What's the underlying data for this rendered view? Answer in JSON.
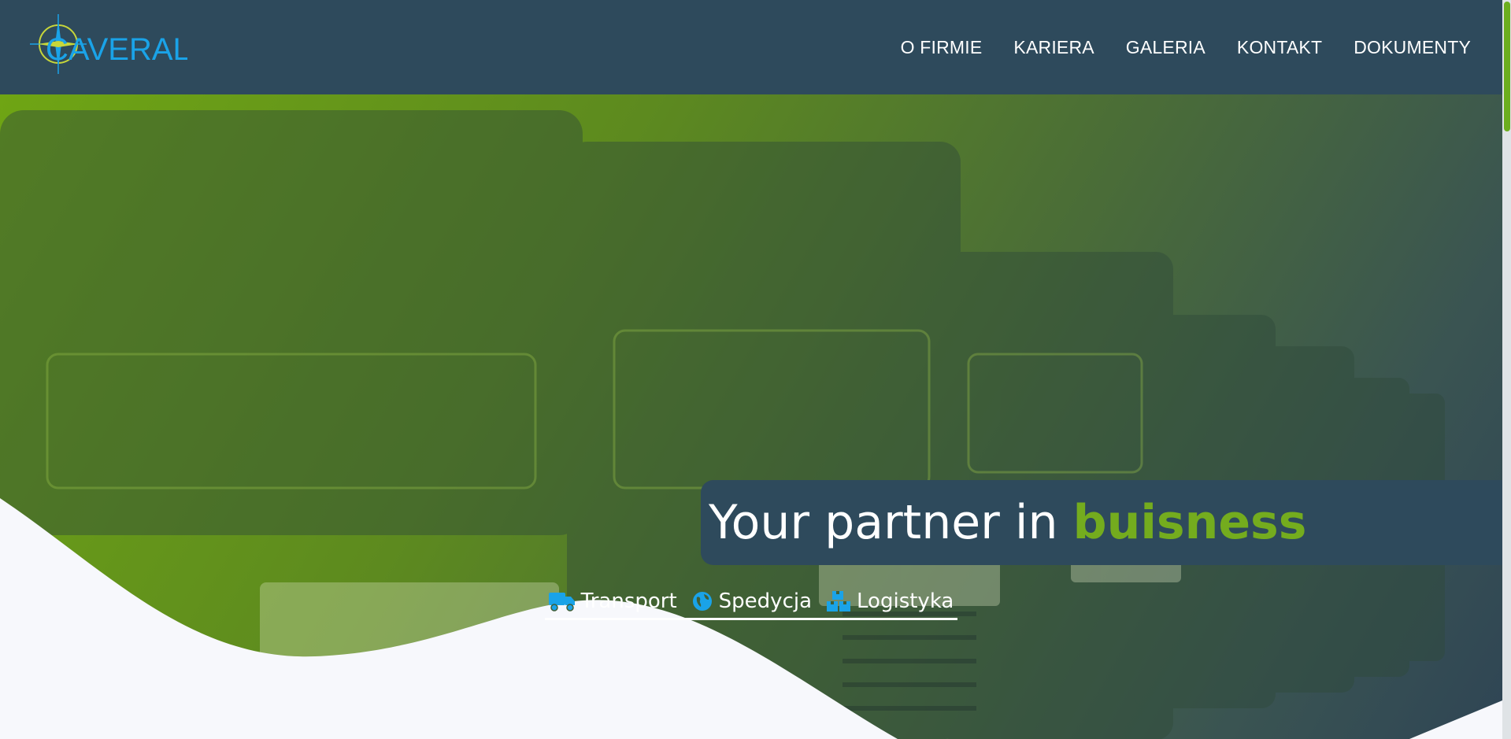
{
  "brand": {
    "logo_text": "CAVERAL"
  },
  "nav": {
    "items": [
      {
        "label": "O FIRMIE"
      },
      {
        "label": "KARIERA"
      },
      {
        "label": "GALERIA"
      },
      {
        "label": "KONTAKT"
      },
      {
        "label": "DOKUMENTY"
      }
    ]
  },
  "hero": {
    "headline_prefix": "Your partner in ",
    "headline_accent": "buisness",
    "services": [
      {
        "label": "Transport",
        "icon": "truck-icon"
      },
      {
        "label": "Spedycja",
        "icon": "globe-icon"
      },
      {
        "label": "Logistyka",
        "icon": "boxes-icon"
      }
    ]
  },
  "colors": {
    "navbar": "#2e4a5c",
    "accent_green": "#74ac1e",
    "icon_blue": "#1aa3e8",
    "page_background": "#f7f8fc"
  }
}
